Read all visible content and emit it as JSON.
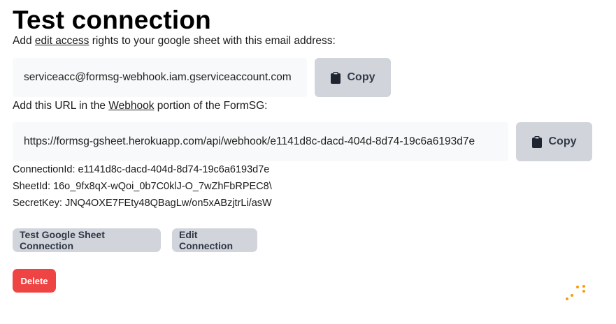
{
  "title": "Test connection",
  "email_instruction": {
    "prefix": "Add ",
    "link": "edit access",
    "suffix": " rights to your google sheet with this email address:"
  },
  "email_field": {
    "value": "serviceacc@formsg-webhook.iam.gserviceaccount.com",
    "copy_label": "Copy"
  },
  "url_instruction": {
    "prefix": "Add this URL in the ",
    "link": "Webhook",
    "suffix": " portion of the FormSG:"
  },
  "url_field": {
    "value": "https://formsg-gsheet.herokuapp.com/api/webhook/e1141d8c-dacd-404d-8d74-19c6a6193d7e",
    "copy_label": "Copy"
  },
  "details": {
    "connection_id": "ConnectionId: e1141d8c-dacd-404d-8d74-19c6a6193d7e",
    "sheet_id": "SheetId: 16o_9fx8qX-wQoi_0b7C0klJ-O_7wZhFbRPEC8\\",
    "secret_key": "SecretKey: JNQ4OXE7FEty48QBagLw/on5xABzjtrLi/asW"
  },
  "actions": {
    "test_label": "Test Google Sheet Connection",
    "edit_label": "Edit Connection",
    "delete_label": "Delete"
  },
  "colors": {
    "button_gray": "#d1d5db",
    "delete_red": "#ef4444",
    "spinner_orange": "#f59e0b",
    "field_bg": "#f8f9fa"
  },
  "icons": {
    "copy": "clipboard-icon",
    "loading": "loading-spinner-icon"
  }
}
